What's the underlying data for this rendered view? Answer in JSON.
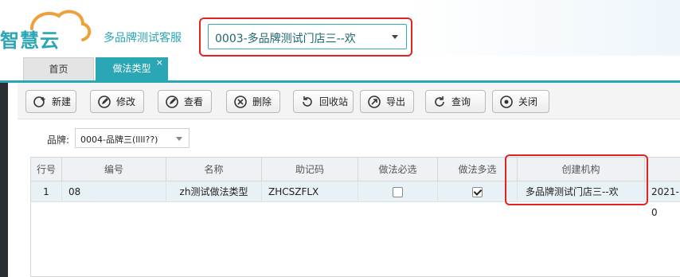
{
  "header": {
    "logo_text": "智慧云",
    "store_name": "多品牌测试客服",
    "store_selected": "0003-多品牌测试门店三--欢"
  },
  "tabs": [
    {
      "label": "首页"
    },
    {
      "label": "做法类型",
      "close": "×"
    }
  ],
  "toolbar": {
    "buttons": [
      {
        "label": "新建",
        "icon": "add-icon"
      },
      {
        "label": "修改",
        "icon": "edit-icon"
      },
      {
        "label": "查看",
        "icon": "view-icon"
      },
      {
        "label": "删除",
        "icon": "delete-icon"
      },
      {
        "label": "回收站",
        "icon": "recycle-icon"
      },
      {
        "label": "导出",
        "icon": "export-icon"
      },
      {
        "label": "查询",
        "icon": "refresh-icon"
      },
      {
        "label": "关闭",
        "icon": "close-icon"
      }
    ]
  },
  "filter": {
    "label": "品牌:",
    "value": "0004-品牌三(llll??)"
  },
  "grid": {
    "columns": [
      "行号",
      "编号",
      "名称",
      "助记码",
      "做法必选",
      "做法多选",
      "创建机构"
    ],
    "rows": [
      {
        "row_no": "1",
        "code": "08",
        "name": "zh测试做法类型",
        "mnemonic": "ZHCSZFLX",
        "required": false,
        "multiple": true,
        "org": "多品牌测试门店三--欢",
        "date": "2021-0"
      }
    ]
  },
  "colors": {
    "brand": "#2aa6b5",
    "highlight": "#e0251c"
  }
}
